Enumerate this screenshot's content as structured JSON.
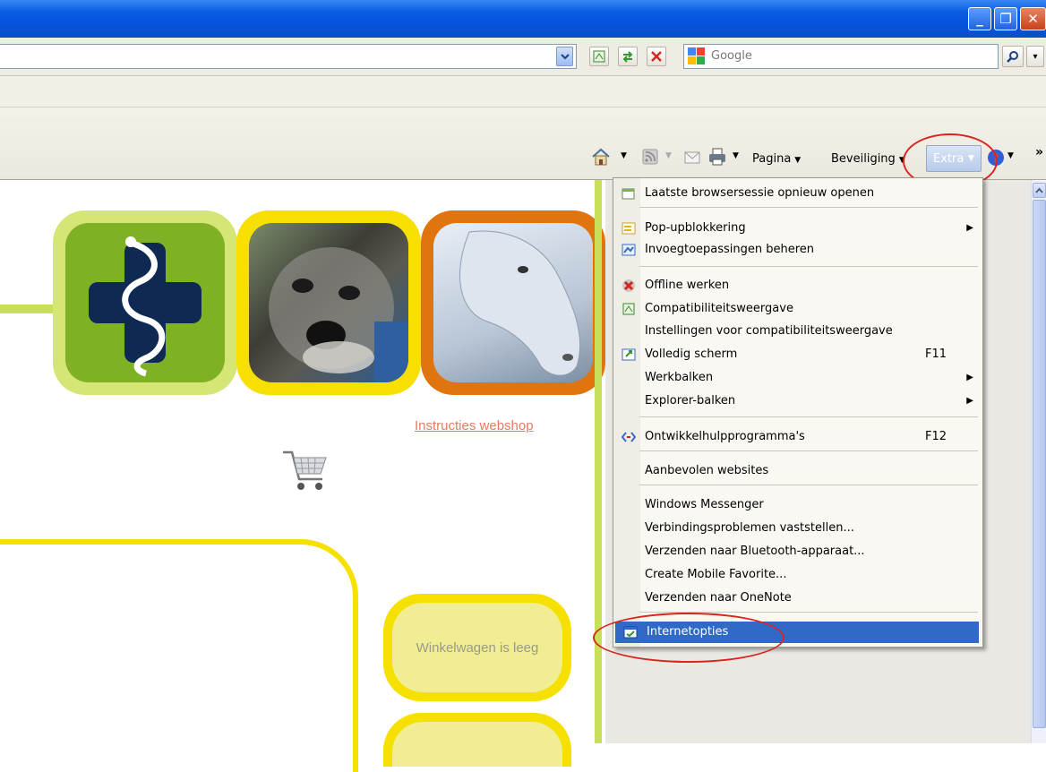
{
  "search": {
    "placeholder": "Google"
  },
  "command_bar": {
    "pagina": "Pagina",
    "beveiliging": "Beveiliging",
    "extra": "Extra",
    "more": "»"
  },
  "window_controls": {
    "minimize": "_",
    "restore": "❐",
    "close": "✕"
  },
  "page": {
    "instructions_link": "Instructies webshop",
    "cart_status": "Winkelwagen is leeg"
  },
  "menu": {
    "items": [
      {
        "label": "Laatste browsersessie opnieuw openen",
        "shortcut": "",
        "submenu": false,
        "icon": "restore-session-icon"
      },
      {
        "label": "Pop-upblokkering",
        "shortcut": "",
        "submenu": true,
        "icon": "popup-blocker-icon"
      },
      {
        "label": "Invoegtoepassingen beheren",
        "shortcut": "",
        "submenu": false,
        "icon": "addons-icon"
      },
      {
        "label": "Offline werken",
        "shortcut": "",
        "submenu": false,
        "icon": "offline-icon"
      },
      {
        "label": "Compatibiliteitsweergave",
        "shortcut": "",
        "submenu": false,
        "icon": "compatibility-icon"
      },
      {
        "label": "Instellingen voor compatibiliteitsweergave",
        "shortcut": "",
        "submenu": false,
        "icon": ""
      },
      {
        "label": "Volledig scherm",
        "shortcut": "F11",
        "submenu": false,
        "icon": "fullscreen-icon"
      },
      {
        "label": "Werkbalken",
        "shortcut": "",
        "submenu": true,
        "icon": ""
      },
      {
        "label": "Explorer-balken",
        "shortcut": "",
        "submenu": true,
        "icon": ""
      },
      {
        "label": "Ontwikkelhulpprogramma's",
        "shortcut": "F12",
        "submenu": false,
        "icon": "developer-tools-icon"
      },
      {
        "label": "Aanbevolen websites",
        "shortcut": "",
        "submenu": false,
        "icon": ""
      },
      {
        "label": "Windows Messenger",
        "shortcut": "",
        "submenu": false,
        "icon": ""
      },
      {
        "label": "Verbindingsproblemen vaststellen...",
        "shortcut": "",
        "submenu": false,
        "icon": ""
      },
      {
        "label": "Verzenden naar Bluetooth-apparaat...",
        "shortcut": "",
        "submenu": false,
        "icon": ""
      },
      {
        "label": "Create Mobile Favorite...",
        "shortcut": "",
        "submenu": false,
        "icon": ""
      },
      {
        "label": "Verzenden naar OneNote",
        "shortcut": "",
        "submenu": false,
        "icon": ""
      },
      {
        "label": "Internetopties",
        "shortcut": "",
        "submenu": false,
        "icon": "internet-options-icon",
        "selected": true
      }
    ]
  },
  "colors": {
    "selection": "#3169c6",
    "highlight_ring": "#d8261f",
    "lime": "#c8df5a",
    "yellow": "#f5e000",
    "orange": "#e0750f",
    "link": "#e87a62"
  }
}
